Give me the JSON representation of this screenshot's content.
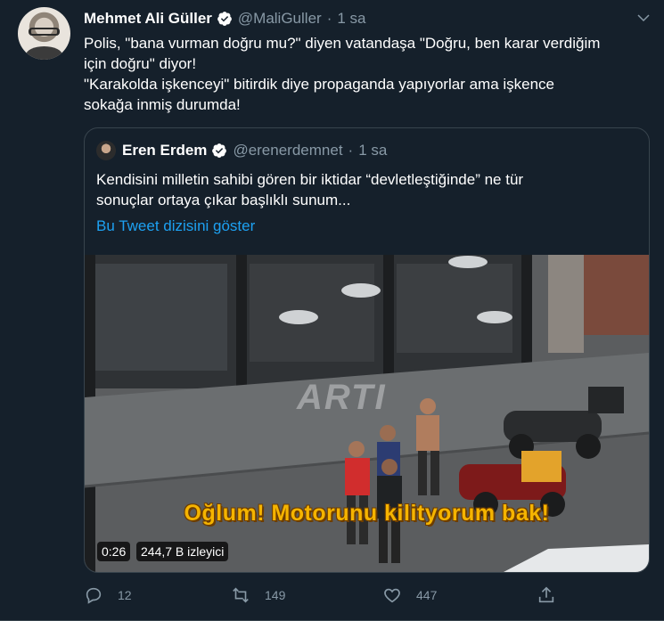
{
  "tweet": {
    "author_name": "Mehmet Ali Güller",
    "handle": "@MaliGuller",
    "time": "1 sa",
    "text": "Polis, \"bana vurman doğru mu?\" diyen vatandaşa \"Doğru, ben karar verdiğim\niçin doğru\" diyor!\n\"Karakolda işkenceyi\" bitirdik diye propaganda yapıyorlar ama işkence\nsokağa inmiş durumda!"
  },
  "quoted": {
    "author_name": "Eren Erdem",
    "handle": "@erenerdemnet",
    "time": "1 sa",
    "text": "Kendisini milletin sahibi gören bir iktidar “devletleştiğinde” ne tür\nsonuçlar ortaya çıkar başlıklı sunum...",
    "thread_link": "Bu Tweet dizisini göster"
  },
  "video": {
    "subtitle": "Oğlum! Motorunu kilityorum bak!",
    "duration": "0:26",
    "views": "244,7 B izleyici",
    "watermark": "ARTI"
  },
  "actions": {
    "reply_count": "12",
    "retweet_count": "149",
    "like_count": "447"
  },
  "colors": {
    "background": "#15202b",
    "muted": "#8899a6",
    "link": "#1da1f2",
    "border": "#38444d"
  }
}
